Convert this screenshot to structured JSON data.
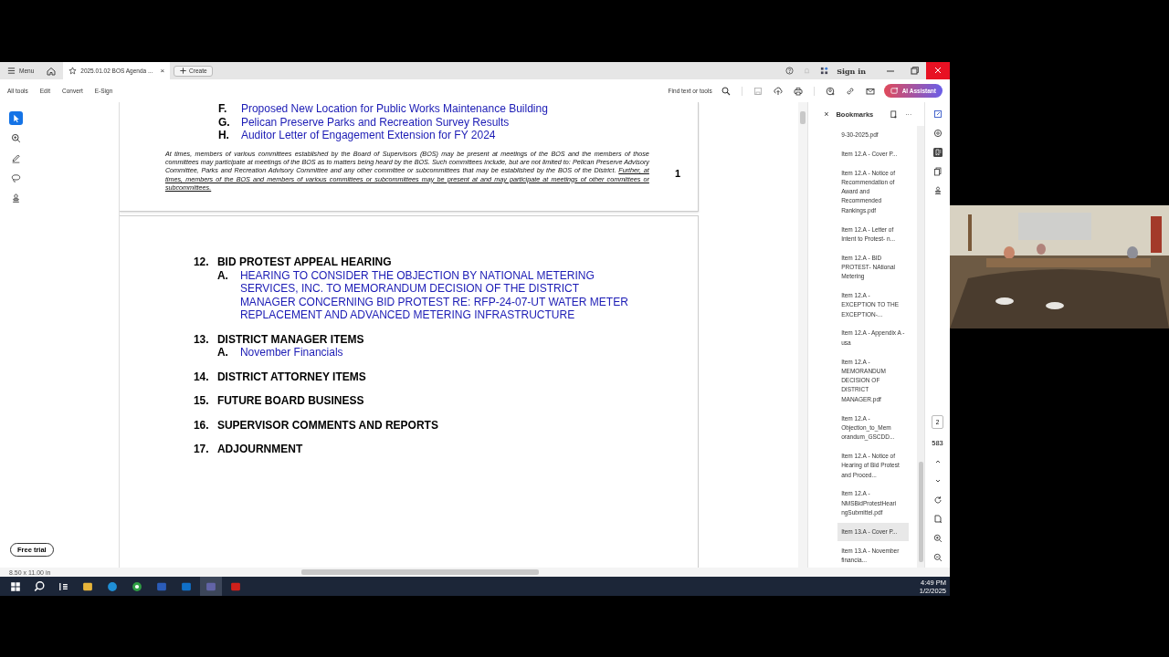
{
  "tabbar": {
    "menu": "Menu",
    "tabs": [
      {
        "title": "2025.01.02 BOS Agenda ...",
        "close": "×",
        "selected": true
      }
    ],
    "create": "Create",
    "sign_in": "Sign in"
  },
  "toolbar": {
    "items": [
      "All tools",
      "Edit",
      "Convert",
      "E-Sign"
    ],
    "find": "Find text or tools",
    "ai": "AI Assistant"
  },
  "left_tools": {
    "tools": [
      {
        "kind": "select",
        "selected": true
      },
      {
        "kind": "zoom",
        "selected": false
      },
      {
        "kind": "pen",
        "selected": false
      },
      {
        "kind": "lasso",
        "selected": false
      },
      {
        "kind": "stamp",
        "selected": false
      }
    ],
    "free_trial": "Free trial"
  },
  "document": {
    "page1": {
      "items": [
        {
          "letter": "F.",
          "text": "Proposed New Location for Public Works Maintenance Building"
        },
        {
          "letter": "G.",
          "text": "Pelican Preserve Parks and Recreation Survey Results"
        },
        {
          "letter": "H.",
          "text": "Auditor Letter of Engagement Extension for FY 2024"
        }
      ],
      "notice": "At times, members of various committees established by the Board of Supervisors (BOS) may be present at meetings of the BOS and the members of those committees may participate at meetings of the BOS as to matters being heard by the BOS. Such committees include, but are not limited to: Pelican Preserve Advisory Committee, Parks and Recreation Advisory Committee and any other committee or subcommittees that may be established by the BOS of the District.",
      "notice_underlined": "Further, at times, members of the BOS and members of various committees or subcommittees may be present at and may participate at meetings of other committees or subcommittees.",
      "page_number": "1"
    },
    "page2": {
      "sections": [
        {
          "number": "12.",
          "title": "BID PROTEST APPEAL HEARING",
          "items": [
            {
              "letter": "A.",
              "text": "HEARING TO CONSIDER THE OBJECTION BY NATIONAL METERING SERVICES, INC. TO MEMORANDUM DECISION OF THE DISTRICT MANAGER CONCERNING BID PROTEST RE: RFP-24-07-UT WATER METER REPLACEMENT AND ADVANCED METERING INFRASTRUCTURE"
            }
          ]
        },
        {
          "number": "13.",
          "title": "DISTRICT MANAGER ITEMS",
          "items": [
            {
              "letter": "A.",
              "text": "November Financials"
            }
          ]
        },
        {
          "number": "14.",
          "title": "DISTRICT ATTORNEY ITEMS"
        },
        {
          "number": "15.",
          "title": "FUTURE BOARD BUSINESS"
        },
        {
          "number": "16.",
          "title": "SUPERVISOR COMMENTS AND REPORTS"
        },
        {
          "number": "17.",
          "title": "ADJOURNMENT"
        }
      ]
    },
    "page_size": "8.50 x 11.00 in"
  },
  "bookmarks": {
    "close": "×",
    "title": "Bookmarks",
    "more": "···",
    "items": [
      {
        "label": "9-30-2025.pdf",
        "selected": false
      },
      {
        "label": "Item 12.A - Cover P...",
        "selected": false
      },
      {
        "label": "Item 12.A - Notice of Recommendation of Award and Recommended Rankings.pdf",
        "selected": false
      },
      {
        "label": "Item 12.A - Letter of Intent to Protest- n...",
        "selected": false
      },
      {
        "label": "Item 12.A - BID PROTEST- NAtional Metering",
        "selected": false
      },
      {
        "label": "Item 12.A - EXCEPTION TO THE EXCEPTION-...",
        "selected": false
      },
      {
        "label": "Item 12.A - Appendix A - usa",
        "selected": false
      },
      {
        "label": "Item 12.A - MEMORANDUM DECISION OF DISTRICT MANAGER.pdf",
        "selected": false
      },
      {
        "label": "Item 12.A - Objection_to_Mem orandum_GSCDD...",
        "selected": false
      },
      {
        "label": "Item 12.A - Notice of Hearing of Bid Protest and Proced...",
        "selected": false
      },
      {
        "label": "Item 12.A - NMSBidProtestHeari ngSubmittel.pdf",
        "selected": false
      },
      {
        "label": "Item 13.A - Cover P...",
        "selected": true
      },
      {
        "label": "Item 13.A - November financia...",
        "selected": false
      }
    ]
  },
  "page_nav": {
    "current": "2",
    "total": "583"
  },
  "taskbar": {
    "apps": [
      {
        "kind": "explorer",
        "selected": false
      },
      {
        "kind": "edge",
        "selected": false
      },
      {
        "kind": "chrome",
        "selected": false
      },
      {
        "kind": "word",
        "selected": false
      },
      {
        "kind": "outlook",
        "selected": false
      },
      {
        "kind": "teams",
        "selected": true
      },
      {
        "kind": "acrobat",
        "selected": false
      }
    ],
    "time": "4:49 PM",
    "date": "1/2/2025"
  }
}
